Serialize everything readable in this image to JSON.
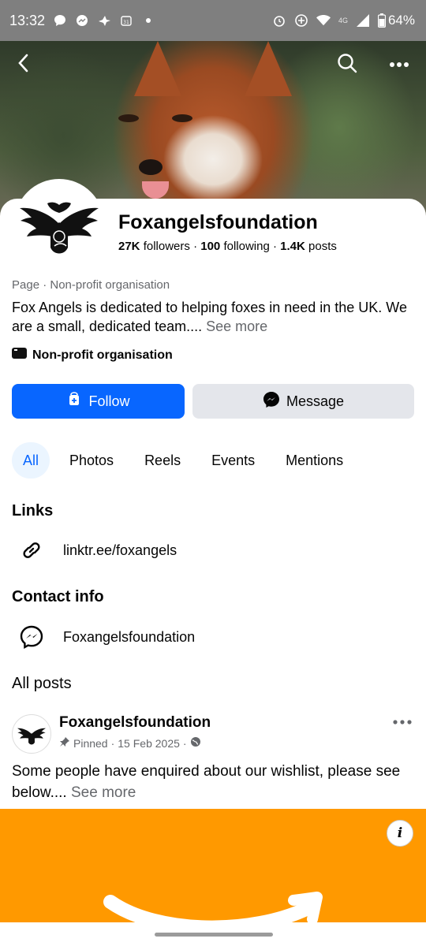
{
  "status_bar": {
    "time": "13:32",
    "network_small": "4G",
    "battery": "64%"
  },
  "profile": {
    "name": "Foxangelsfoundation",
    "followers_count": "27K",
    "followers_label": "followers",
    "following_count": "100",
    "following_label": "following",
    "posts_count": "1.4K",
    "posts_label": "posts",
    "category": "Page · Non-profit organisation",
    "bio": "Fox Angels is dedicated to helping foxes in need in the UK. We are a small, dedicated team....",
    "see_more": "See more",
    "org_type": "Non-profit organisation"
  },
  "actions": {
    "follow_label": "Follow",
    "message_label": "Message"
  },
  "tabs": [
    {
      "label": "All"
    },
    {
      "label": "Photos"
    },
    {
      "label": "Reels"
    },
    {
      "label": "Events"
    },
    {
      "label": "Mentions"
    }
  ],
  "links": {
    "title": "Links",
    "url": "linktr.ee/foxangels"
  },
  "contact": {
    "title": "Contact info",
    "messenger": "Foxangelsfoundation"
  },
  "posts": {
    "title": "All posts",
    "author": "Foxangelsfoundation",
    "pinned": "Pinned",
    "date": "15 Feb 2025",
    "text": "Some people have enquired about our wishlist, please see below....",
    "see_more": "See more",
    "image_bg": "#ff9900"
  },
  "colors": {
    "accent": "#0866ff",
    "secondary_button": "#e4e6eb",
    "muted_text": "#65676b"
  }
}
